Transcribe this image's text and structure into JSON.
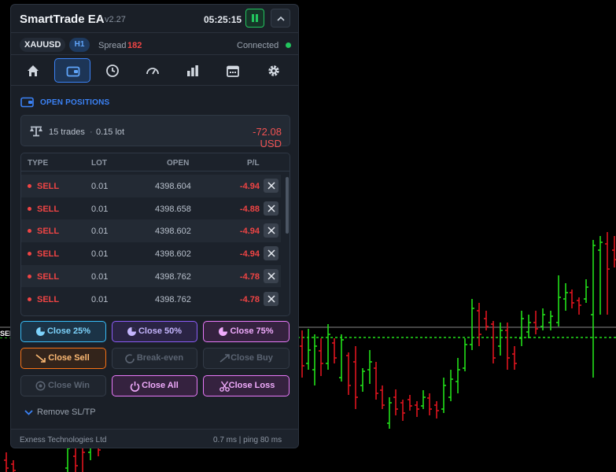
{
  "header": {
    "title": "SmartTrade EA",
    "version": "v2.27",
    "clock": "05:25:15"
  },
  "info": {
    "symbol": "XAUUSD",
    "timeframe": "H1",
    "spread_label": "Spread",
    "spread_value": "182",
    "connection": "Connected"
  },
  "nav": {
    "items": [
      "home-icon",
      "wallet-icon",
      "clock-icon",
      "gauge-icon",
      "bar-chart-icon",
      "calendar-icon",
      "gear-icon"
    ],
    "active": "wallet-icon"
  },
  "positions": {
    "section_title": "OPEN POSITIONS",
    "summary": {
      "trades": "15 trades",
      "separator": "·",
      "lot": "0.15 lot",
      "pl": "-72.08 USD"
    },
    "columns": [
      "TYPE",
      "LOT",
      "OPEN",
      "P/L"
    ],
    "rows": [
      {
        "type": "SELL",
        "lot": "0.01",
        "open": "4398.604",
        "pl": "-4.94"
      },
      {
        "type": "SELL",
        "lot": "0.01",
        "open": "4398.658",
        "pl": "-4.88"
      },
      {
        "type": "SELL",
        "lot": "0.01",
        "open": "4398.602",
        "pl": "-4.94"
      },
      {
        "type": "SELL",
        "lot": "0.01",
        "open": "4398.602",
        "pl": "-4.94"
      },
      {
        "type": "SELL",
        "lot": "0.01",
        "open": "4398.762",
        "pl": "-4.78"
      },
      {
        "type": "SELL",
        "lot": "0.01",
        "open": "4398.762",
        "pl": "-4.78"
      }
    ]
  },
  "actions": {
    "close25": "Close 25%",
    "close50": "Close 50%",
    "close75": "Close 75%",
    "close_sell": "Close Sell",
    "break_even": "Break-even",
    "close_buy": "Close Buy",
    "close_win": "Close Win",
    "close_all": "Close All",
    "close_loss": "Close Loss",
    "remove_sltp": "Remove SL/TP"
  },
  "footer": {
    "broker": "Exness Technologies Ltd",
    "latency": "0.7 ms  |  ping 80 ms"
  },
  "chart_overlay": {
    "sell_tag": "SELL"
  },
  "colors": {
    "accent": "#3b82f6",
    "loss": "#ef4444",
    "connected": "#22c55e",
    "bull_candle": "#22e01a",
    "bear_candle": "#e0141e"
  }
}
